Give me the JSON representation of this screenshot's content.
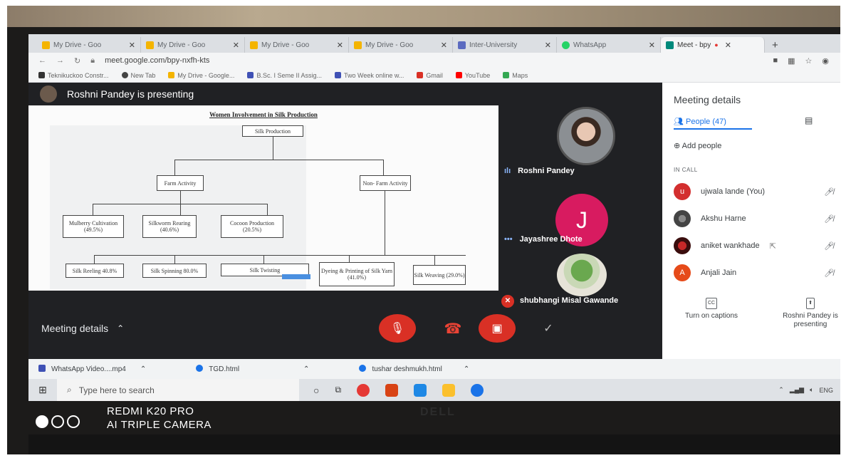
{
  "browser": {
    "tabs": [
      {
        "label": "My Drive - Goo",
        "color": "#f4b400"
      },
      {
        "label": "My Drive - Goo",
        "color": "#f4b400"
      },
      {
        "label": "My Drive - Goo",
        "color": "#f4b400"
      },
      {
        "label": "My Drive - Goo",
        "color": "#f4b400"
      },
      {
        "label": "Inter-University",
        "color": "#5c6bc0"
      },
      {
        "label": "WhatsApp",
        "color": "#25d366"
      },
      {
        "label": "Meet - bpy",
        "color": "#00897b"
      }
    ],
    "url": "meet.google.com/bpy-nxfh-kts",
    "bookmarks": [
      "Teknikuckoo Constr...",
      "New Tab",
      "My Drive - Google...",
      "B.Sc. I Seme II Assig...",
      "Two Week online w...",
      "Gmail",
      "YouTube",
      "Maps"
    ]
  },
  "meet": {
    "presenting_banner": "Roshni Pandey is presenting",
    "slide": {
      "title": "Women Involvement in Silk Production",
      "root": "Silk Production",
      "branches": [
        "Farm Activity",
        "Non- Farm Activity"
      ],
      "farm": [
        "Mulberry Cultivation (49.5%)",
        "Silkworm Rearing (40.6%)",
        "Cocoon Production (20.5%)"
      ],
      "nonfarm": [
        "Silk Reeling 40.8%",
        "Silk Spinning 80.0%",
        "Silk Twisting",
        "Dyeing & Printing of Silk Yarn (41.0%)",
        "Silk Weaving (29.0%)"
      ]
    },
    "tiles": [
      {
        "name": "Roshni Pandey"
      },
      {
        "name": "Jayashree Dhote",
        "initial": "J",
        "color": "#d81b60"
      },
      {
        "name": "shubhangi Misal Gawande"
      }
    ],
    "meeting_details_label": "Meeting details",
    "side_panel": {
      "header": "Meeting details",
      "people_tab": "People (47)",
      "add_people": "Add people",
      "in_call_label": "IN CALL",
      "people": [
        {
          "name": "ujwala lande (You)",
          "initial": "u",
          "color": "#d32f2f"
        },
        {
          "name": "Akshu Harne",
          "initial": "",
          "color": "#555555"
        },
        {
          "name": "aniket wankhade",
          "initial": "",
          "color": "#8b1c1c"
        },
        {
          "name": "Anjali Jain",
          "initial": "A",
          "color": "#e64a19"
        }
      ],
      "captions": "Turn on captions",
      "presenting": "Roshni Pandey is presenting"
    }
  },
  "downloads": [
    "WhatsApp Video....mp4",
    "TGD.html",
    "tushar deshmukh.html"
  ],
  "taskbar": {
    "search_placeholder": "Type here to search",
    "lang": "ENG"
  },
  "watermark": {
    "line1": "REDMI K20 PRO",
    "line2": "AI TRIPLE CAMERA"
  },
  "bezel_logo": "DELL"
}
